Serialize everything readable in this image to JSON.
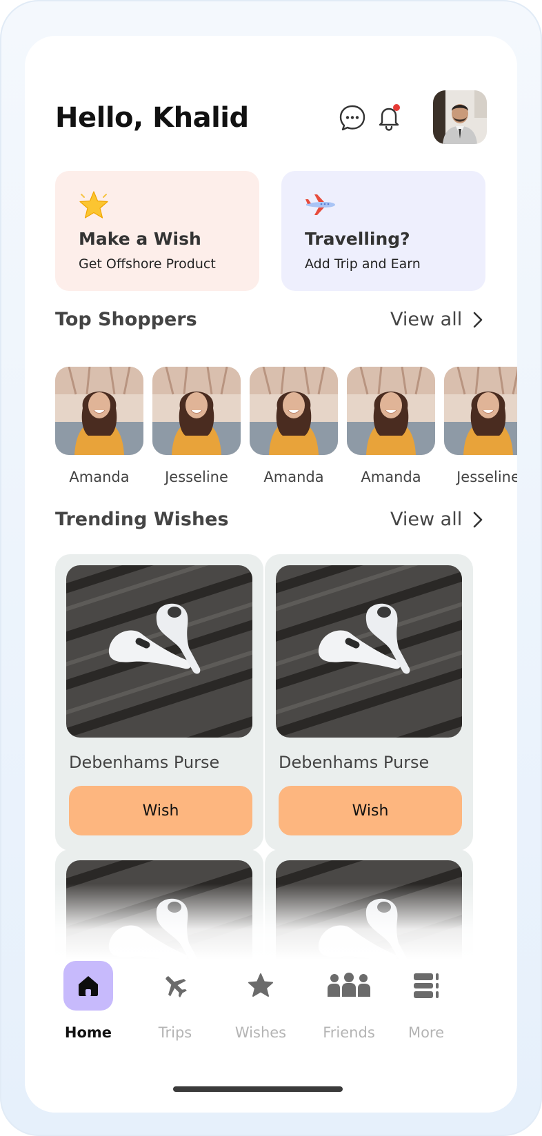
{
  "header": {
    "greeting": "Hello, Khalid",
    "chat_icon": "chat-bubble-icon",
    "notification_icon": "bell-icon",
    "has_unread_notification": true
  },
  "promos": [
    {
      "icon": "star-icon",
      "title": "Make a Wish",
      "subtitle": "Get Offshore Product",
      "color": "#fdeeea"
    },
    {
      "icon": "airplane-icon",
      "title": "Travelling?",
      "subtitle": "Add Trip and Earn",
      "color": "#eeeffd"
    }
  ],
  "top_shoppers": {
    "title": "Top Shoppers",
    "view_all": "View all",
    "items": [
      {
        "name": "Amanda"
      },
      {
        "name": "Jesseline"
      },
      {
        "name": "Amanda"
      },
      {
        "name": "Amanda"
      },
      {
        "name": "Jesseline"
      }
    ]
  },
  "trending": {
    "title": "Trending Wishes",
    "view_all": "View all",
    "items": [
      {
        "name": "Debenhams Purse",
        "button": "Wish"
      },
      {
        "name": "Debenhams Purse",
        "button": "Wish"
      },
      {
        "name": "",
        "button": ""
      },
      {
        "name": "",
        "button": ""
      }
    ]
  },
  "nav": {
    "items": [
      {
        "label": "Home",
        "icon": "home-icon",
        "active": true
      },
      {
        "label": "Trips",
        "icon": "airplane-icon",
        "active": false
      },
      {
        "label": "Wishes",
        "icon": "star-icon",
        "active": false
      },
      {
        "label": "Friends",
        "icon": "friends-icon",
        "active": false
      },
      {
        "label": "More",
        "icon": "more-icon",
        "active": false
      }
    ]
  },
  "colors": {
    "accent_button": "#fdb67f",
    "active_nav": "#c7bafc",
    "notification_dot": "#e53935"
  }
}
